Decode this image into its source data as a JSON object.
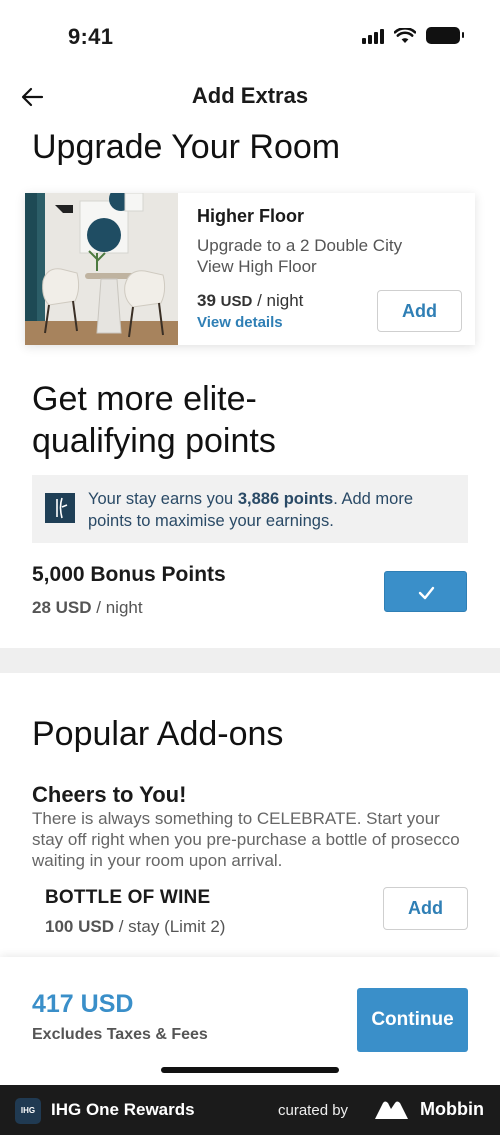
{
  "status_bar": {
    "time": "9:41"
  },
  "header": {
    "title": "Add Extras"
  },
  "upgrade_section": {
    "heading": "Upgrade Your Room",
    "card": {
      "title": "Higher Floor",
      "description": "Upgrade to a 2 Double City View High Floor",
      "price_amount": "39",
      "price_currency": "USD",
      "price_unit": "/ night",
      "details_link": "View details",
      "add_label": "Add"
    }
  },
  "points_section": {
    "heading": "Get more elite-qualifying points",
    "info_prefix": "Your stay earns you ",
    "info_points": "3,886 points",
    "info_suffix": ". Add more points to maximise your earnings.",
    "bonus_title": "5,000 Bonus Points",
    "bonus_price": "28 USD",
    "bonus_unit": "/ night",
    "bonus_selected": true
  },
  "addons_section": {
    "heading": "Popular Add-ons",
    "item_title": "Cheers to You!",
    "item_description": "There is always something to CELEBRATE. Start your stay off right when you pre-purchase a bottle of prosecco waiting in your room upon arrival.",
    "product_name": "BOTTLE OF WINE",
    "product_price": "100 USD",
    "product_unit": "/ stay (Limit 2)",
    "add_label": "Add"
  },
  "footer": {
    "total": "417 USD",
    "note": "Excludes Taxes & Fees",
    "continue_label": "Continue"
  },
  "brand_bar": {
    "logo_text": "IHG",
    "app_name": "IHG One Rewards",
    "curated_by": "curated by",
    "curator": "Mobbin"
  },
  "colors": {
    "accent": "#3a8fc9",
    "link": "#2f7fb5",
    "info_text": "#2a4a66",
    "info_bg": "#f1f1f1"
  }
}
